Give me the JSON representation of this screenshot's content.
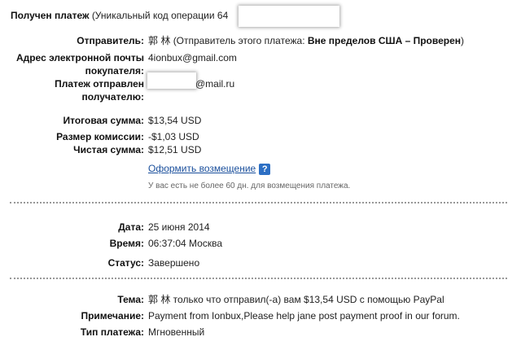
{
  "header": {
    "title": "Получен платеж",
    "subtitle": "(Уникальный код операции 64"
  },
  "sender": {
    "label": "Отправитель:",
    "name": "郭 林",
    "note_prefix": "(Отправитель этого платежа:",
    "note_status": "Вне пределов США – Проверен",
    "note_suffix": ")"
  },
  "buyer_email": {
    "label": "Адрес электронной почты покупателя:",
    "value": "4ionbux@gmail.com"
  },
  "recipient": {
    "label": "Платеж отправлен получателю:",
    "value": "@mail.ru"
  },
  "amounts": {
    "total_label": "Итоговая сумма:",
    "total_value": "$13,54 USD",
    "fee_label": "Размер комиссии:",
    "fee_value": "-$1,03 USD",
    "net_label": "Чистая сумма:",
    "net_value": "$12,51 USD",
    "refund_link": "Оформить возмещение",
    "help_glyph": "?",
    "refund_note": "У вас есть не более 60 дн. для возмещения платежа."
  },
  "details": {
    "date_label": "Дата:",
    "date_value": "25 июня 2014",
    "time_label": "Время:",
    "time_value": "06:37:04 Москва",
    "status_label": "Статус:",
    "status_value": "Завершено"
  },
  "message": {
    "subject_label": "Тема:",
    "subject_value": "郭 林 только что отправил(-а) вам $13,54 USD с помощью PayPal",
    "note_label": "Примечание:",
    "note_value": "Payment from Ionbux,Please help jane post payment proof in our forum.",
    "type_label": "Тип платежа:",
    "type_value": "Мгновенный"
  }
}
